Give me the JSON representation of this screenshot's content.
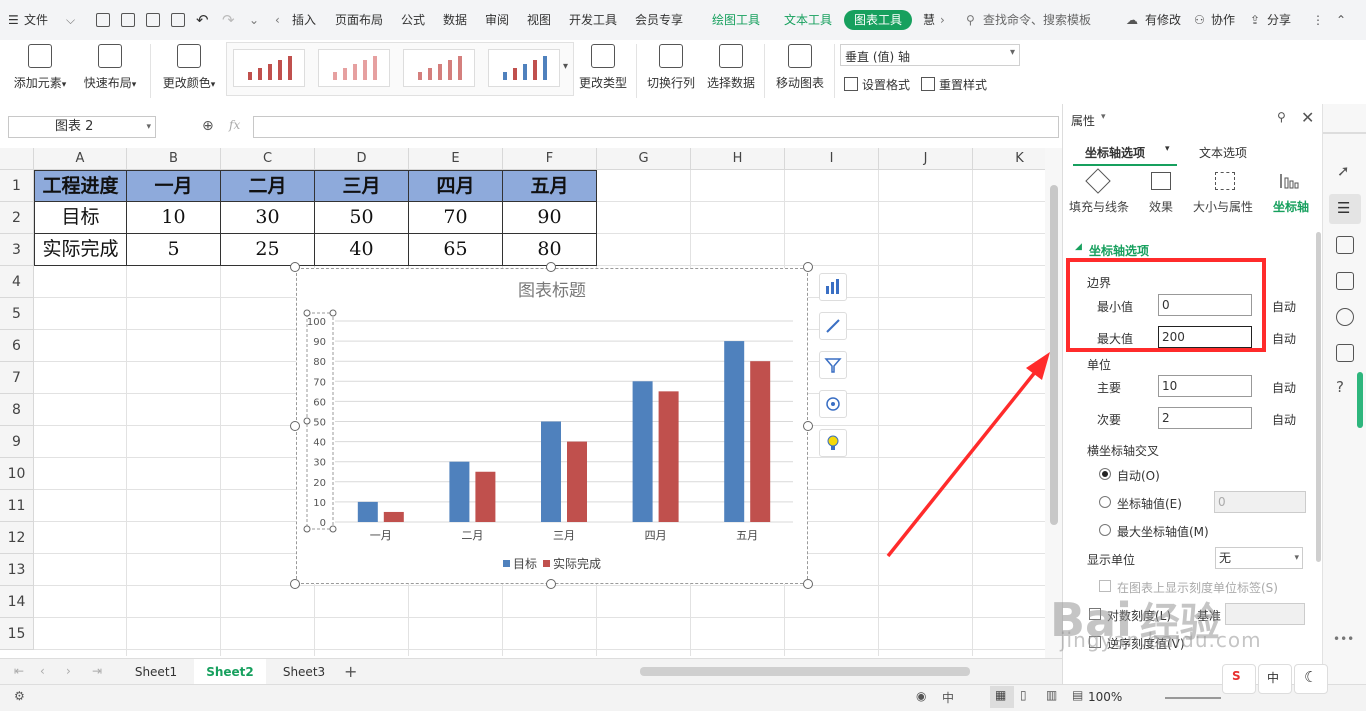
{
  "topbar": {
    "file": "文件",
    "tabs": [
      "插入",
      "页面布局",
      "公式",
      "数据",
      "审阅",
      "视图",
      "开发工具",
      "会员专享"
    ],
    "drawing_tools": "绘图工具",
    "text_tools": "文本工具",
    "chart_tools": "图表工具",
    "more": "慧",
    "search_placeholder": "查找命令、搜索模板",
    "changes": "有修改",
    "collab": "协作",
    "share": "分享"
  },
  "ribbon": {
    "add_element": "添加元素",
    "quick_layout": "快速布局",
    "change_color": "更改颜色",
    "change_type": "更改类型",
    "switch_rowcol": "切换行列",
    "select_data": "选择数据",
    "move_chart": "移动图表",
    "element_select": "垂直 (值) 轴",
    "set_format": "设置格式",
    "reset_style": "重置样式"
  },
  "formula_bar": {
    "name_box": "图表 2",
    "fx": "fx"
  },
  "grid": {
    "columns": [
      "A",
      "B",
      "C",
      "D",
      "E",
      "F",
      "G",
      "H",
      "I",
      "J",
      "K"
    ],
    "rows": [
      "1",
      "2",
      "3",
      "4",
      "5",
      "6",
      "7",
      "8",
      "9",
      "10",
      "11",
      "12",
      "13",
      "14",
      "15"
    ],
    "table": [
      [
        "工程进度",
        "一月",
        "二月",
        "三月",
        "四月",
        "五月"
      ],
      [
        "目标",
        "10",
        "30",
        "50",
        "70",
        "90"
      ],
      [
        "实际完成",
        "5",
        "25",
        "40",
        "65",
        "80"
      ]
    ]
  },
  "chart_data": {
    "type": "bar",
    "title": "图表标题",
    "categories": [
      "一月",
      "二月",
      "三月",
      "四月",
      "五月"
    ],
    "series": [
      {
        "name": "目标",
        "values": [
          10,
          30,
          50,
          70,
          90
        ],
        "color": "#4f81bd"
      },
      {
        "name": "实际完成",
        "values": [
          5,
          25,
          40,
          65,
          80
        ],
        "color": "#c0504d"
      }
    ],
    "ylim": [
      0,
      100
    ],
    "yticks": [
      0,
      10,
      20,
      30,
      40,
      50,
      60,
      70,
      80,
      90,
      100
    ],
    "grid": true,
    "legend": "bottom"
  },
  "sheets": {
    "tabs": [
      "Sheet1",
      "Sheet2",
      "Sheet3"
    ],
    "active": "Sheet2",
    "add": "+"
  },
  "panel": {
    "title": "属性",
    "tab_axis": "坐标轴选项",
    "tab_text": "文本选项",
    "sub_fill": "填充与线条",
    "sub_effect": "效果",
    "sub_size": "大小与属性",
    "sub_axis": "坐标轴",
    "section": "坐标轴选项",
    "bounds": "边界",
    "min_label": "最小值",
    "min_value": "0",
    "max_label": "最大值",
    "max_value": "200",
    "auto": "自动",
    "units": "单位",
    "major_label": "主要",
    "major_value": "10",
    "minor_label": "次要",
    "minor_value": "2",
    "cross": "横坐标轴交叉",
    "cross_auto": "自动(O)",
    "cross_value": "坐标轴值(E)",
    "cross_value_input": "0",
    "cross_max": "最大坐标轴值(M)",
    "display_units": "显示单位",
    "display_units_value": "无",
    "show_units_label": "在图表上显示刻度单位标签(S)",
    "log_scale": "对数刻度(L)",
    "log_base": "基准",
    "reverse": "逆序刻度值(V)"
  },
  "status": {
    "zoom": "100%"
  },
  "watermark": {
    "text1": "Bai",
    "text2": "经验",
    "url": "jingyan.baidu.com"
  },
  "colors": {
    "accent": "#17a05e",
    "header_fill": "#8eaadb",
    "highlight": "#ff2b2b"
  }
}
